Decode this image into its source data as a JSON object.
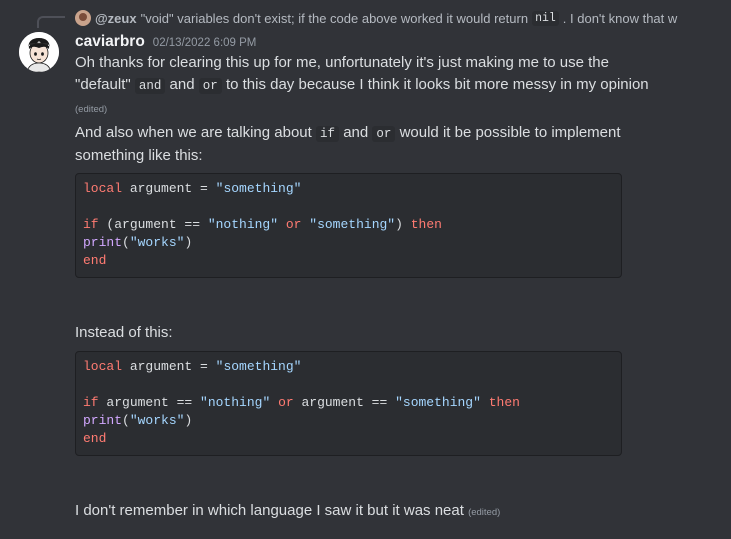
{
  "reply": {
    "author": "@zeux",
    "text_before": "\"void\" variables don't exist; if the code above worked it would return",
    "code": "nil",
    "text_after": ". I don't know that w"
  },
  "message": {
    "username": "caviarbro",
    "timestamp": "02/13/2022 6:09 PM",
    "edited_label": "(edited)",
    "p1": {
      "line1": "Oh thanks for clearing this up for me, unfortunately it's just making me to use the",
      "quote_default": "\"default\"",
      "code_and": "and",
      "word_and": "and",
      "code_or": "or",
      "tail": "to this day because I think it looks bit more messy in my opinion"
    },
    "p2": {
      "part1": "And also when we are talking about",
      "code_if": "if",
      "word_and": "and",
      "code_or": "or",
      "part2": "would it be possible to implement",
      "line2": "something like this:"
    },
    "code1": {
      "l1_kw": "local",
      "l1_mid": " argument = ",
      "l1_str": "\"something\"",
      "l3_kw": "if",
      "l3_a": " (argument == ",
      "l3_s1": "\"nothing\"",
      "l3_or": "or",
      "l3_s2": "\"something\"",
      "l3_b": ") ",
      "l3_then": "then",
      "l4_fn": "print",
      "l4_a": "(",
      "l4_str": "\"works\"",
      "l4_b": ")",
      "l5_kw": "end"
    },
    "p3": "Instead of this:",
    "code2": {
      "l1_kw": "local",
      "l1_mid": " argument = ",
      "l1_str": "\"something\"",
      "l3_kw": "if",
      "l3_a": " argument == ",
      "l3_s1": "\"nothing\"",
      "l3_or": "or",
      "l3_b": " argument == ",
      "l3_s2": "\"something\"",
      "l3_then": "then",
      "l4_fn": "print",
      "l4_a": "(",
      "l4_str": "\"works\"",
      "l4_b": ")",
      "l5_kw": "end"
    },
    "p4": "I don't remember in which language I saw it but it was neat"
  },
  "colors": {
    "background": "#313338",
    "keyword": "#ff7b72",
    "string": "#a5d6ff",
    "function": "#d2a8ff"
  }
}
